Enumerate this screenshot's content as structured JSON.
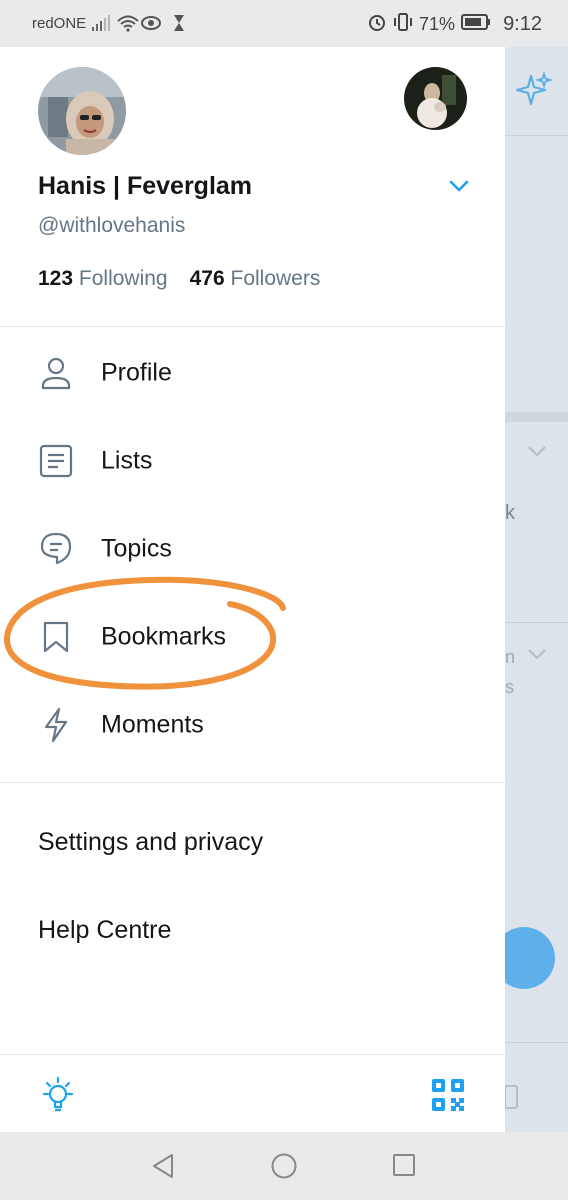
{
  "status_bar": {
    "carrier": "redONE",
    "battery_percent": "71%",
    "time": "9:12"
  },
  "profile": {
    "display_name": "Hanis | Feverglam",
    "handle": "@withlovehanis",
    "following_count": "123",
    "following_label": "Following",
    "followers_count": "476",
    "followers_label": "Followers"
  },
  "menu": {
    "profile": "Profile",
    "lists": "Lists",
    "topics": "Topics",
    "bookmarks": "Bookmarks",
    "moments": "Moments"
  },
  "secondary_menu": {
    "settings": "Settings and privacy",
    "help": "Help Centre"
  },
  "background": {
    "partial_text_1": "k",
    "partial_text_2": "n",
    "partial_text_3": "s"
  },
  "colors": {
    "accent": "#1da1f2",
    "annotation": "#f0913c",
    "text_primary": "#14171a",
    "text_secondary": "#657786"
  },
  "icons": {
    "sparkle": "sparkle-icon",
    "bulb": "lightbulb-icon",
    "qr": "qr-code-icon"
  }
}
